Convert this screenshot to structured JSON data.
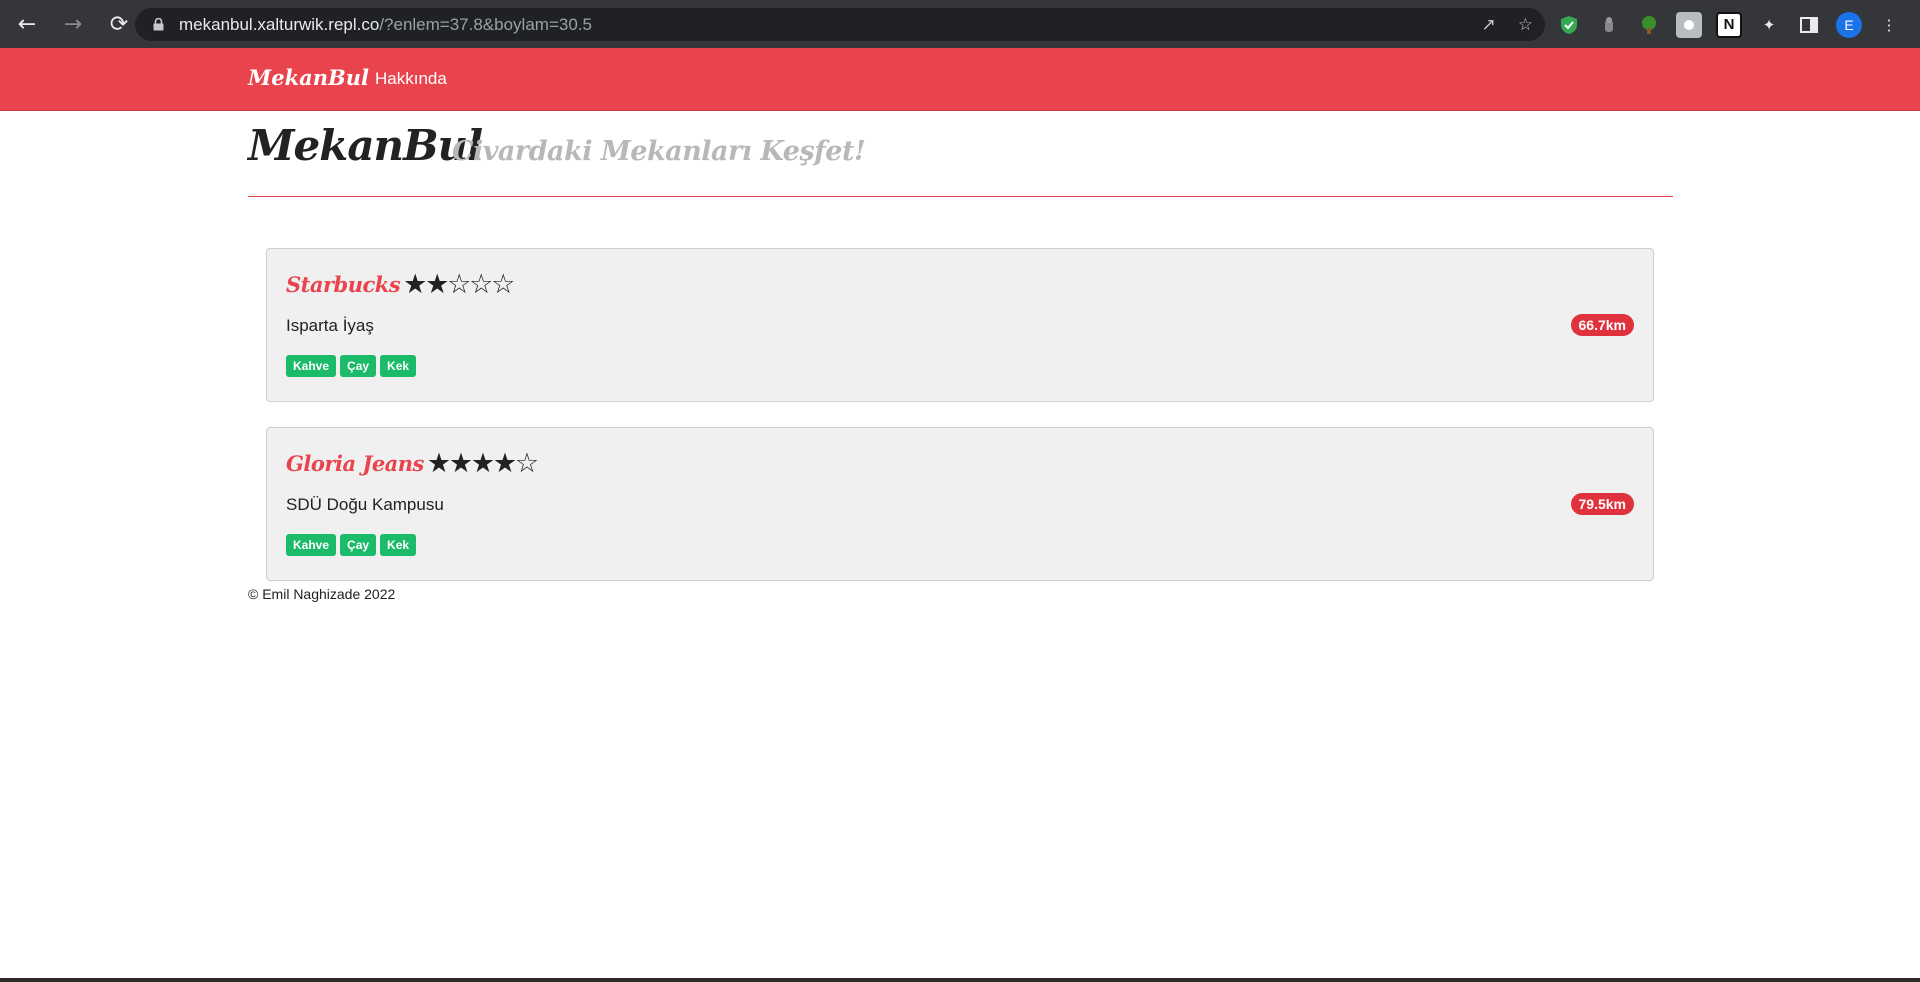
{
  "browser": {
    "url_host": "mekanbul.xalturwik.repl.co",
    "url_rest": "/?enlem=37.8&boylam=30.5",
    "profile_initial": "E"
  },
  "navbar": {
    "brand": "MekanBul",
    "links": [
      {
        "label": "Hakkında"
      }
    ]
  },
  "header": {
    "title": "MekanBul",
    "tagline": "Civardaki Mekanları Keşfet!"
  },
  "venues": [
    {
      "name": "Starbucks",
      "rating": 2,
      "stars": [
        "★",
        "★",
        "☆",
        "☆",
        "☆"
      ],
      "address": "Isparta İyaş",
      "distance": "66.7km",
      "tags": [
        "Kahve",
        "Çay",
        "Kek"
      ]
    },
    {
      "name": "Gloria Jeans",
      "rating": 4,
      "stars": [
        "★",
        "★",
        "★",
        "★",
        "☆"
      ],
      "address": "SDÜ Doğu Kampusu",
      "distance": "79.5km",
      "tags": [
        "Kahve",
        "Çay",
        "Kek"
      ]
    }
  ],
  "footer": {
    "text": "© Emil Naghizade 2022"
  },
  "colors": {
    "brand_red": "#e9434d",
    "tag_green": "#1cbb6a",
    "badge_red": "#e0323c"
  }
}
